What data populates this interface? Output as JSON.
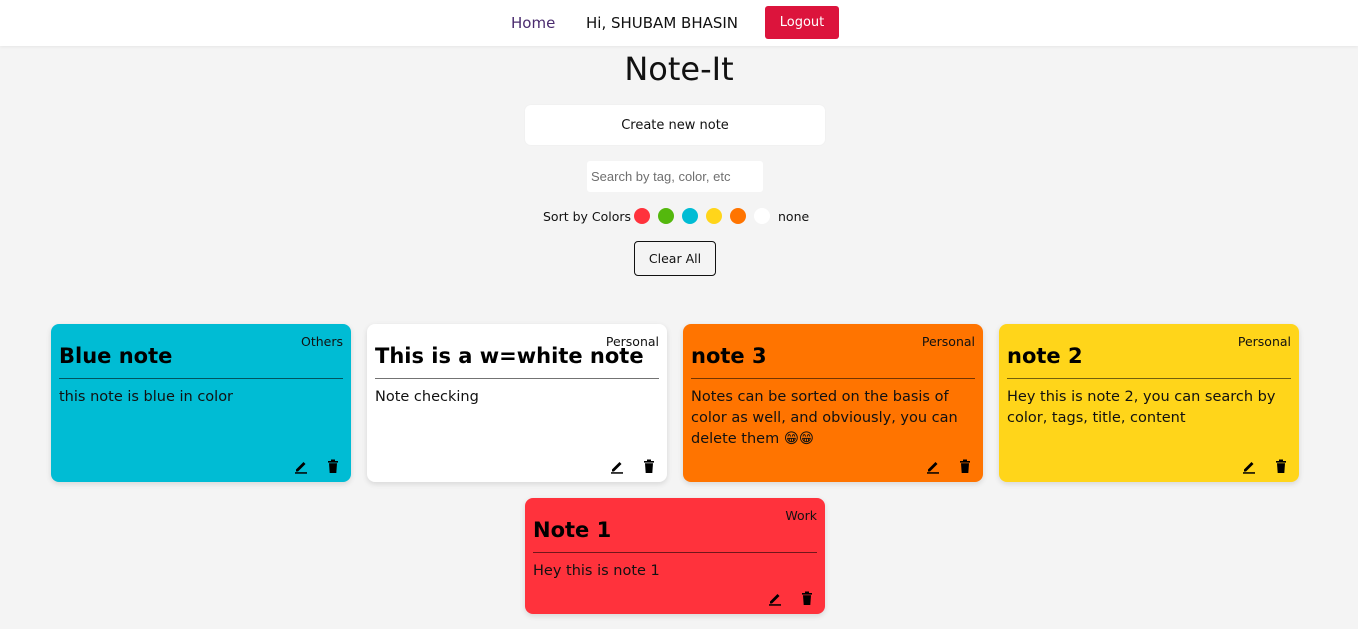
{
  "nav": {
    "home_label": "Home",
    "greeting": "Hi, SHUBAM BHASIN",
    "logout_label": "Logout",
    "logout_color": "#dc143c"
  },
  "app_title": "Note-It",
  "create_button_label": "Create new note",
  "search": {
    "placeholder": "Search by tag, color, etc"
  },
  "sort": {
    "label": "Sort by Colors",
    "colors": [
      "#ff323c",
      "#54b80d",
      "#00bcd4",
      "#ffd51a",
      "#ff7400",
      "#ffffff"
    ],
    "none_label": "none"
  },
  "clear_all_label": "Clear All",
  "notes": [
    {
      "tag": "Others",
      "title": "Blue note",
      "content": "this note is blue in color",
      "color": "#00bcd4"
    },
    {
      "tag": "Personal",
      "title": "This is a w=white note",
      "content": "Note checking",
      "color": "#ffffff"
    },
    {
      "tag": "Personal",
      "title": "note 3",
      "content": "Notes can be sorted on the basis of color as well, and obviously, you can delete them 😁😁",
      "color": "#ff7400"
    },
    {
      "tag": "Personal",
      "title": "note 2",
      "content": "Hey this is note 2, you can search by color, tags, title, content",
      "color": "#ffd51a"
    },
    {
      "tag": "Work",
      "title": "Note 1",
      "content": "Hey this is note 1",
      "color": "#ff323c"
    }
  ],
  "icons": {
    "edit": "pencil-icon",
    "delete": "trash-icon"
  }
}
